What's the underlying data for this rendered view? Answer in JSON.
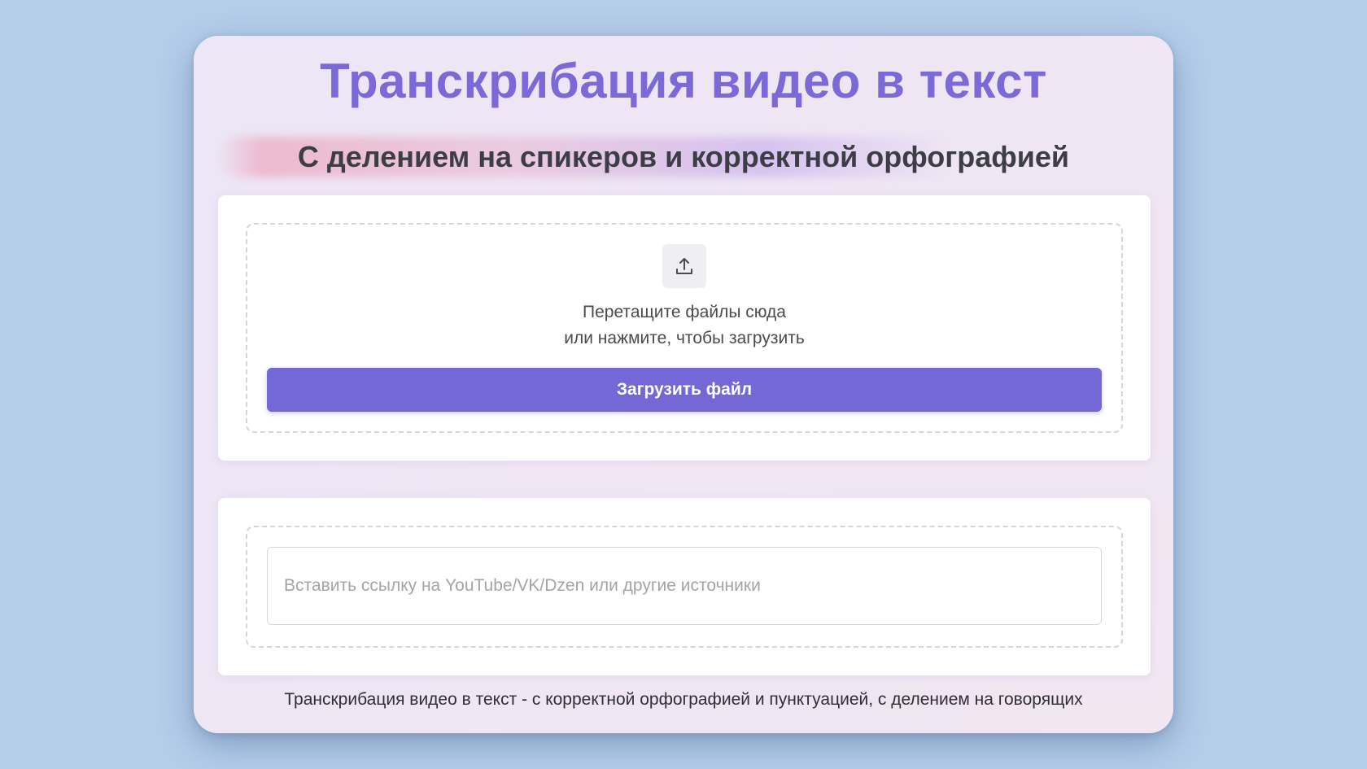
{
  "header": {
    "title": "Транскрибация видео в текст",
    "subtitle": "С делением на спикеров и корректной орфографией"
  },
  "upload": {
    "icon": "upload-icon",
    "drop_line1": "Перетащите файлы сюда",
    "drop_line2": "или нажмите, чтобы загрузить",
    "button_label": "Загрузить файл"
  },
  "link": {
    "placeholder": "Вставить ссылку на YouTube/VK/Dzen или другие источники",
    "value": ""
  },
  "footer": {
    "text": "Транскрибация видео в текст - с корректной орфографией и пунктуацией, с делением на говорящих"
  },
  "colors": {
    "background": "#b4cde9",
    "accent": "#7467d6",
    "title": "#7b69d8"
  }
}
